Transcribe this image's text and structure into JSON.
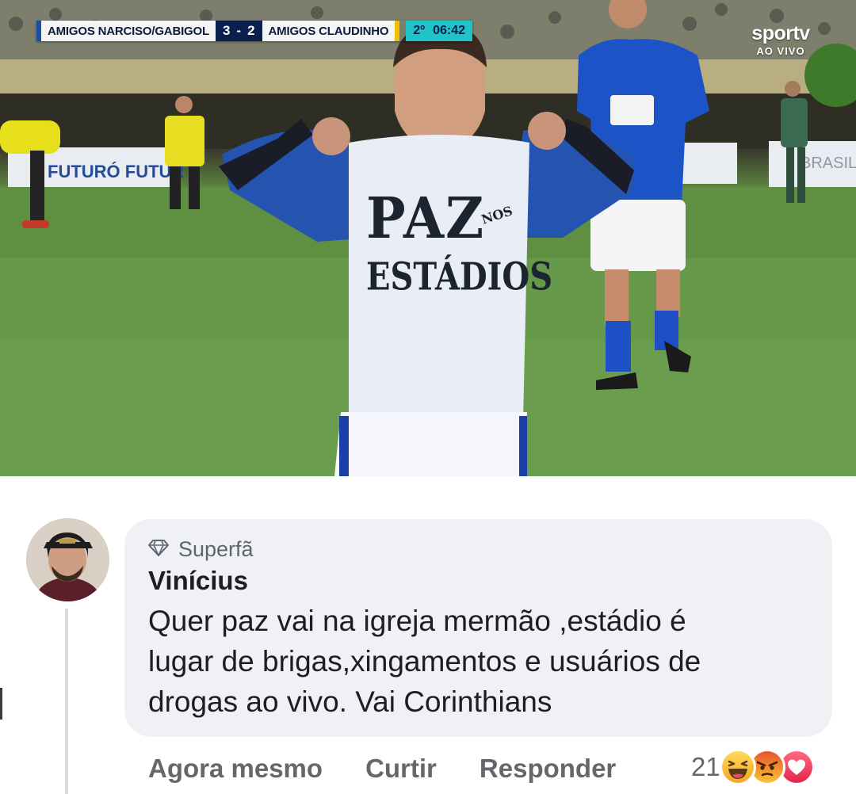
{
  "video": {
    "scoreboard": {
      "home_team": "AMIGOS NARCISO/GABIGOL",
      "home_score": "3",
      "separator": "-",
      "away_score": "2",
      "away_team": "AMIGOS CLAUDINHO",
      "period": "2º",
      "clock": "06:42"
    },
    "broadcaster": {
      "name": "sportv",
      "live_label": "AO VIVO"
    },
    "shirt": {
      "line1": "PAZ",
      "line1_small": "NOS",
      "line2": "ESTÁDIOS"
    },
    "board_text_left": "FUTURÓ   FUTUR",
    "board_text_right": "BRASIL"
  },
  "comment": {
    "badge_icon": "diamond-icon",
    "badge_label": "Superfã",
    "author": "Vinícius",
    "text_lines": [
      "Quer paz vai na igreja mermão ,estádio é",
      "lugar de brigas,xingamentos e usuários de",
      "drogas ao vivo. Vai Corinthians"
    ],
    "timestamp": "Agora mesmo",
    "like_label": "Curtir",
    "reply_label": "Responder",
    "reaction_count": "21",
    "reactions": [
      "haha-reaction",
      "angry-reaction",
      "love-reaction"
    ]
  },
  "colors": {
    "bubble": "#eff1f4",
    "meta_text": "#65676b",
    "scoreboard_navy": "#0b1f4d",
    "scoreboard_cyan": "#1fc3c8"
  }
}
